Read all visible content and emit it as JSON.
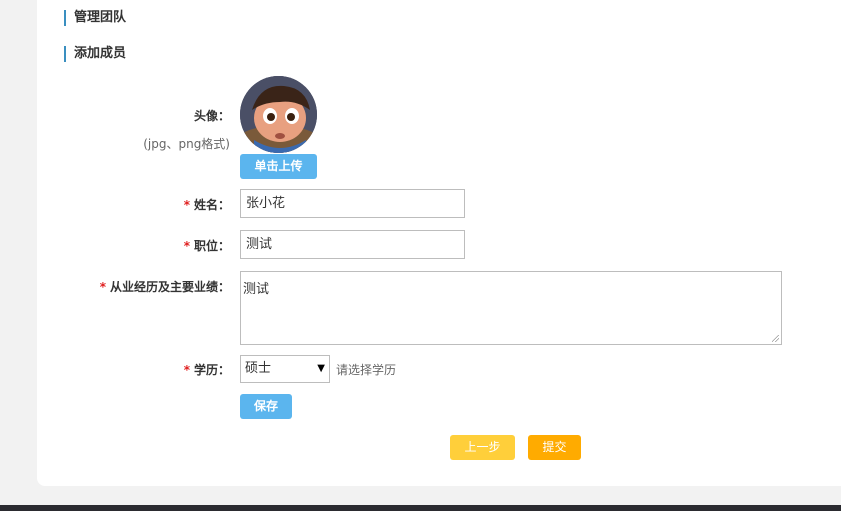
{
  "sections": {
    "manage_team": "管理团队",
    "add_member": "添加成员"
  },
  "avatar": {
    "label": "头像：",
    "format_hint": "(jpg、png格式)",
    "upload_label": "单击上传"
  },
  "form": {
    "required_mark": "*",
    "name_label": "姓名：",
    "name_value": "张小花",
    "position_label": "职位：",
    "position_value": "测试",
    "experience_label": "从业经历及主要业绩：",
    "experience_value": "测试",
    "education_label": "学历：",
    "education_value": "硕士",
    "education_hint": "请选择学历",
    "select_arrow_icon": "▼",
    "save_label": "保存"
  },
  "nav": {
    "prev_label": "上一步",
    "submit_label": "提交"
  },
  "colors": {
    "primary_button": "#5bb5ee",
    "prev_button": "#ffcf3a",
    "submit_button": "#ffab00",
    "required": "#e02020",
    "section_accent": "#3a8fc0"
  }
}
